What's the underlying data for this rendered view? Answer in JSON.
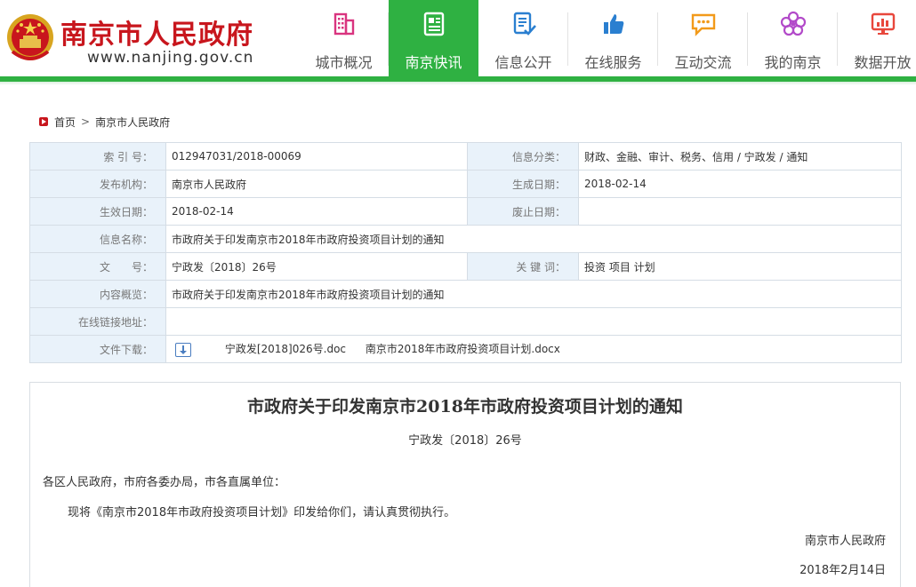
{
  "header": {
    "site_name": "南京市人民政府",
    "site_url": "www.nanjing.gov.cn",
    "nav": [
      {
        "label": "城市概况",
        "icon": "building-icon",
        "color": "#d9347f"
      },
      {
        "label": "南京快讯",
        "icon": "newspaper-icon",
        "color": "#ffffff",
        "active": true
      },
      {
        "label": "信息公开",
        "icon": "document-check-icon",
        "color": "#2a7fd0"
      },
      {
        "label": "在线服务",
        "icon": "thumbs-up-icon",
        "color": "#2a7fd0"
      },
      {
        "label": "互动交流",
        "icon": "chat-bubble-icon",
        "color": "#f29a1a"
      },
      {
        "label": "我的南京",
        "icon": "flower-icon",
        "color": "#b24ac9"
      },
      {
        "label": "数据开放",
        "icon": "monitor-chart-icon",
        "color": "#e8473c"
      }
    ],
    "accent_color": "#2fb142",
    "brand_color": "#c8161d"
  },
  "breadcrumb": {
    "home": "首页",
    "separator": ">",
    "current": "南京市人民政府"
  },
  "info": {
    "index_label": "索 引 号：",
    "index_value": "012947031/2018-00069",
    "category_label": "信息分类：",
    "category_value": "财政、金融、审计、税务、信用 / 宁政发 / 通知",
    "publisher_label": "发布机构：",
    "publisher_value": "南京市人民政府",
    "created_label": "生成日期：",
    "created_value": "2018-02-14",
    "effective_label": "生效日期：",
    "effective_value": "2018-02-14",
    "expiry_label": "废止日期：",
    "expiry_value": "",
    "name_label": "信息名称：",
    "name_value": "市政府关于印发南京市2018年市政府投资项目计划的通知",
    "docno_label": "文　　号：",
    "docno_value": "宁政发〔2018〕26号",
    "keywords_label": "关 键 词：",
    "keywords_value": "投资 项目 计划",
    "summary_label": "内容概览：",
    "summary_value": "市政府关于印发南京市2018年市政府投资项目计划的通知",
    "link_label": "在线链接地址：",
    "link_value": "",
    "download_label": "文件下载：",
    "files": [
      "宁政发[2018]026号.doc",
      "南京市2018年市政府投资项目计划.docx"
    ]
  },
  "article": {
    "title": "市政府关于印发南京市2018年市政府投资项目计划的通知",
    "doc_number": "宁政发〔2018〕26号",
    "recipients": "各区人民政府，市府各委办局，市各直属单位：",
    "body": "现将《南京市2018年市政府投资项目计划》印发给你们，请认真贯彻执行。",
    "signature": "南京市人民政府",
    "date": "2018年2月14日"
  }
}
